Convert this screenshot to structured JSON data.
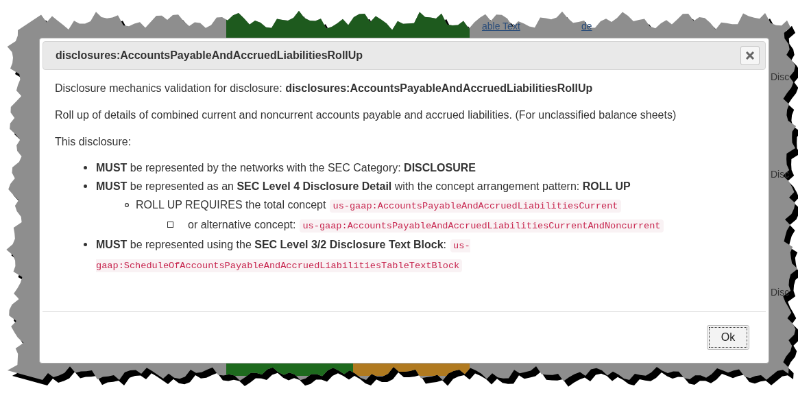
{
  "background": {
    "texts": [
      {
        "kind": "link",
        "text": "able Text"
      },
      {
        "kind": "link",
        "text": "de"
      },
      {
        "kind": "label",
        "text": "Disc"
      },
      {
        "kind": "label",
        "text": "Disc"
      },
      {
        "kind": "label",
        "text": "Disc"
      }
    ]
  },
  "dialog": {
    "title": "disclosures:AccountsPayableAndAccruedLiabilitiesRollUp",
    "intro": "Disclosure mechanics validation for disclosure: **disclosures:AccountsPayableAndAccruedLiabilitiesRollUp**",
    "description": "Roll up of details of combined current and noncurrent accounts payable and accrued liabilities. (For unclassified balance sheets)",
    "lead": "This disclosure:",
    "rules": [
      {
        "text": "**MUST** be represented by the networks with the SEC Category: **DISCLOSURE**"
      },
      {
        "text": "**MUST** be represented as an **SEC Level 4 Disclosure Detail** with the concept arrangement pattern: **ROLL UP**",
        "children": [
          {
            "text": "ROLL UP REQUIRES the total concept",
            "code": "us-gaap:AccountsPayableAndAccruedLiabilitiesCurrent",
            "children": [
              {
                "text": "or alternative concept:",
                "code": "us-gaap:AccountsPayableAndAccruedLiabilitiesCurrentAndNoncurrent"
              }
            ]
          }
        ]
      },
      {
        "text": "**MUST** be represented using the **SEC Level 3/2 Disclosure Text Block**:",
        "code": "us-gaap:ScheduleOfAccountsPayableAndAccruedLiabilitiesTableTextBlock"
      }
    ],
    "buttons": [
      "Ok"
    ]
  }
}
